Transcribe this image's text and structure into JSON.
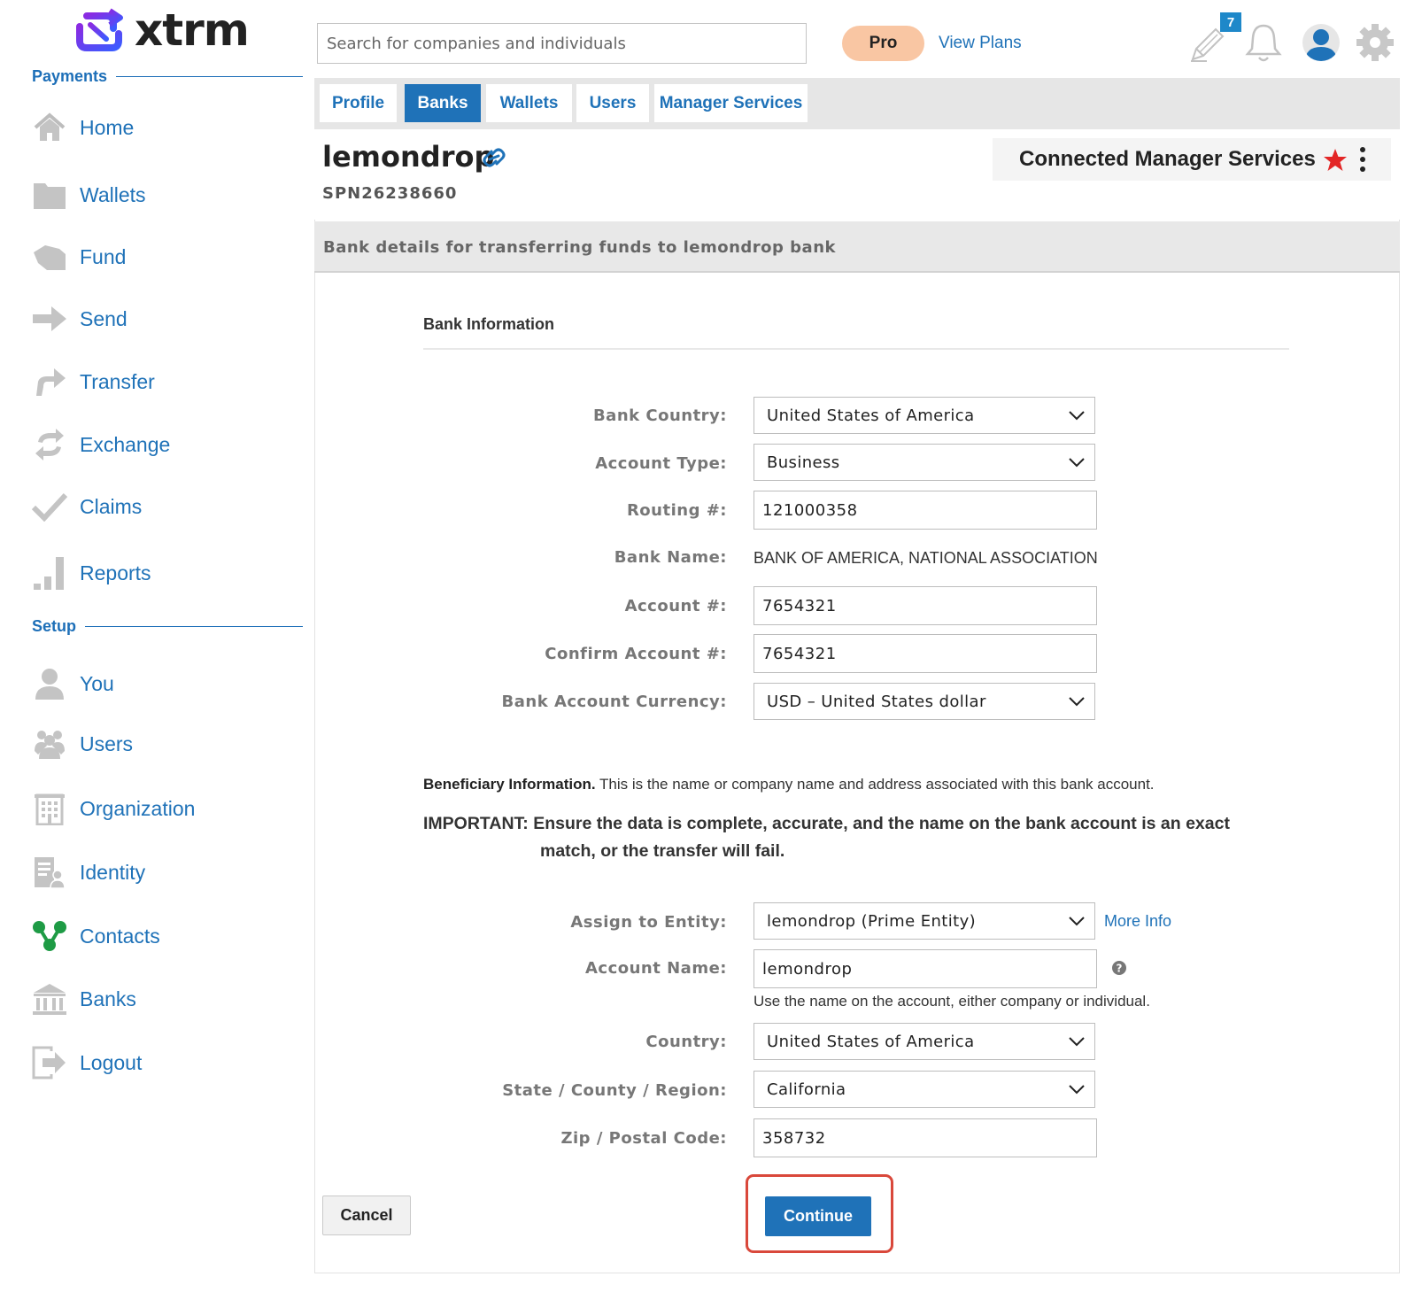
{
  "app": {
    "logo_text": "xtrm"
  },
  "sidebar": {
    "payments_heading": "Payments",
    "setup_heading": "Setup",
    "payments_items": [
      {
        "label": "Home",
        "icon": "home-icon"
      },
      {
        "label": "Wallets",
        "icon": "folder-icon"
      },
      {
        "label": "Fund",
        "icon": "fund-icon"
      },
      {
        "label": "Send",
        "icon": "send-arrow-icon"
      },
      {
        "label": "Transfer",
        "icon": "transfer-arrow-icon"
      },
      {
        "label": "Exchange",
        "icon": "exchange-icon"
      },
      {
        "label": "Claims",
        "icon": "checkmark-icon"
      },
      {
        "label": "Reports",
        "icon": "bar-chart-icon"
      }
    ],
    "setup_items": [
      {
        "label": "You",
        "icon": "person-icon"
      },
      {
        "label": "Users",
        "icon": "users-icon"
      },
      {
        "label": "Organization",
        "icon": "building-icon"
      },
      {
        "label": "Identity",
        "icon": "identity-icon"
      },
      {
        "label": "Contacts",
        "icon": "contacts-icon"
      },
      {
        "label": "Banks",
        "icon": "bank-icon"
      },
      {
        "label": "Logout",
        "icon": "logout-icon"
      }
    ]
  },
  "header": {
    "search_placeholder": "Search for companies and individuals",
    "pro_label": "Pro",
    "view_plans_label": "View Plans",
    "notification_count": "7",
    "icons": [
      "edit-icon",
      "bell-icon",
      "user-avatar-icon",
      "gear-icon"
    ]
  },
  "tabs": [
    {
      "label": "Profile",
      "active": false
    },
    {
      "label": "Banks",
      "active": true
    },
    {
      "label": "Wallets",
      "active": false
    },
    {
      "label": "Users",
      "active": false
    },
    {
      "label": "Manager Services",
      "active": false
    }
  ],
  "account": {
    "name": "lemondrop",
    "id": "SPN26238660",
    "connected_label": "Connected Manager Services"
  },
  "transfer_strip": "Bank details for transferring funds to lemondrop bank",
  "bank_info": {
    "heading": "Bank Information",
    "bank_country": {
      "label": "Bank Country:",
      "value": "United States of America"
    },
    "account_type": {
      "label": "Account Type:",
      "value": "Business"
    },
    "routing": {
      "label": "Routing #:",
      "value": "121000358"
    },
    "bank_name": {
      "label": "Bank Name:",
      "value": "BANK OF AMERICA, NATIONAL ASSOCIATION"
    },
    "account_number": {
      "label": "Account #:",
      "value": "7654321"
    },
    "confirm_account": {
      "label": "Confirm Account #:",
      "value": "7654321"
    },
    "currency": {
      "label": "Bank Account Currency:",
      "value": "USD – United States dollar"
    }
  },
  "beneficiary": {
    "title": "Beneficiary Information.",
    "text": " This is the name or company name and address associated with this bank account.",
    "important_line1": "IMPORTANT: Ensure the data is complete, accurate, and the name on the bank account is an exact",
    "important_line2": "match, or the transfer will fail.",
    "entity": {
      "label": "Assign to Entity:",
      "value": "lemondrop (Prime Entity)"
    },
    "more_info": "More Info",
    "account_name": {
      "label": "Account Name:",
      "value": "lemondrop"
    },
    "account_name_hint": "Use the name on the account, either company or individual.",
    "country": {
      "label": "Country:",
      "value": "United States of America"
    },
    "state": {
      "label": "State / County / Region:",
      "value": "California"
    },
    "zip": {
      "label": "Zip / Postal Code:",
      "value": "358732"
    }
  },
  "actions": {
    "cancel": "Cancel",
    "continue": "Continue"
  },
  "colors": {
    "accent": "#1f72b8",
    "logo_purple": "#7b2ff7",
    "pro_badge": "#f9c6a3",
    "star": "#e32626",
    "highlight": "#d9483b",
    "contacts_green": "#1e9b45"
  }
}
